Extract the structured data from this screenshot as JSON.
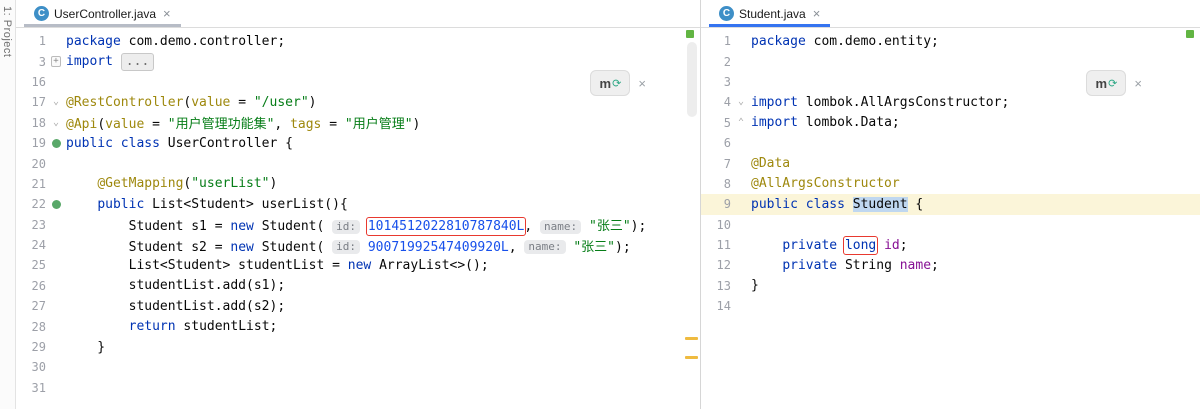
{
  "colors": {
    "accent_focused_tab": "#3574f0",
    "annotation_box_red": "#e8392f",
    "bean_icon_green": "#59a869",
    "inspection_ok_green": "#62b543",
    "warning_stripe_yellow": "#efbb40",
    "keyword_blue": "#0033b3",
    "string_green": "#067d17",
    "number_blue": "#1750eb"
  },
  "project_strip": {
    "label": "1: Project"
  },
  "inline_widget": {
    "logo": "m",
    "sync_icon": "circular-arrows",
    "close": "×"
  },
  "panes": [
    {
      "tab": {
        "icon_letter": "C",
        "title": "UserController.java",
        "close": "×"
      },
      "focused": false,
      "lines": [
        {
          "n": "1",
          "tokens": [
            {
              "c": "kw",
              "t": "package "
            },
            {
              "c": "txt",
              "t": "com.demo.controller;"
            }
          ]
        },
        {
          "n": "3",
          "icon": "plus",
          "tokens": [
            {
              "c": "kw",
              "t": "import "
            },
            {
              "c": "fold",
              "t": "..."
            }
          ]
        },
        {
          "n": "16",
          "tokens": []
        },
        {
          "n": "17",
          "icon": "chev",
          "tokens": [
            {
              "c": "ann",
              "t": "@RestController"
            },
            {
              "c": "txt",
              "t": "("
            },
            {
              "c": "ann",
              "t": "value"
            },
            {
              "c": "txt",
              "t": " = "
            },
            {
              "c": "str",
              "t": "\"/user\""
            },
            {
              "c": "txt",
              "t": ")"
            }
          ]
        },
        {
          "n": "18",
          "icon": "chev",
          "tokens": [
            {
              "c": "ann",
              "t": "@Api"
            },
            {
              "c": "txt",
              "t": "("
            },
            {
              "c": "ann",
              "t": "value"
            },
            {
              "c": "txt",
              "t": " = "
            },
            {
              "c": "str",
              "t": "\"用户管理功能集\""
            },
            {
              "c": "txt",
              "t": ", "
            },
            {
              "c": "ann",
              "t": "tags"
            },
            {
              "c": "txt",
              "t": " = "
            },
            {
              "c": "str",
              "t": "\"用户管理\""
            },
            {
              "c": "txt",
              "t": ")"
            }
          ]
        },
        {
          "n": "19",
          "icon": "bean",
          "tokens": [
            {
              "c": "kw",
              "t": "public class "
            },
            {
              "c": "txt",
              "t": "UserController {"
            }
          ]
        },
        {
          "n": "20",
          "tokens": []
        },
        {
          "n": "21",
          "tokens": [
            {
              "c": "txt",
              "t": "    "
            },
            {
              "c": "ann",
              "t": "@GetMapping"
            },
            {
              "c": "txt",
              "t": "("
            },
            {
              "c": "str",
              "t": "\"userList\""
            },
            {
              "c": "txt",
              "t": ")"
            }
          ]
        },
        {
          "n": "22",
          "icon": "bean",
          "tokens": [
            {
              "c": "txt",
              "t": "    "
            },
            {
              "c": "kw",
              "t": "public "
            },
            {
              "c": "txt",
              "t": "List<Student> userList(){"
            }
          ]
        },
        {
          "n": "23",
          "tokens": [
            {
              "c": "txt",
              "t": "        Student s1 = "
            },
            {
              "c": "kw",
              "t": "new "
            },
            {
              "c": "txt",
              "t": "Student( "
            },
            {
              "c": "inlay",
              "t": "id:"
            },
            {
              "c": "txt",
              "t": " "
            },
            {
              "c": "num",
              "t": "1014512022810787840L",
              "box": true
            },
            {
              "c": "txt",
              "t": ", "
            },
            {
              "c": "inlay",
              "t": "name:"
            },
            {
              "c": "txt",
              "t": " "
            },
            {
              "c": "str",
              "t": "\"张三\""
            },
            {
              "c": "txt",
              "t": ");"
            }
          ]
        },
        {
          "n": "24",
          "tokens": [
            {
              "c": "txt",
              "t": "        Student s2 = "
            },
            {
              "c": "kw",
              "t": "new "
            },
            {
              "c": "txt",
              "t": "Student( "
            },
            {
              "c": "inlay",
              "t": "id:"
            },
            {
              "c": "txt",
              "t": " "
            },
            {
              "c": "num",
              "t": "90071992547409920L"
            },
            {
              "c": "txt",
              "t": ", "
            },
            {
              "c": "inlay",
              "t": "name:"
            },
            {
              "c": "txt",
              "t": " "
            },
            {
              "c": "str",
              "t": "\"张三\""
            },
            {
              "c": "txt",
              "t": ");"
            }
          ]
        },
        {
          "n": "25",
          "tokens": [
            {
              "c": "txt",
              "t": "        List<Student> studentList = "
            },
            {
              "c": "kw",
              "t": "new "
            },
            {
              "c": "txt",
              "t": "ArrayList<>();"
            }
          ]
        },
        {
          "n": "26",
          "tokens": [
            {
              "c": "txt",
              "t": "        studentList.add(s1);"
            }
          ]
        },
        {
          "n": "27",
          "tokens": [
            {
              "c": "txt",
              "t": "        studentList.add(s2);"
            }
          ]
        },
        {
          "n": "28",
          "tokens": [
            {
              "c": "txt",
              "t": "        "
            },
            {
              "c": "kw",
              "t": "return "
            },
            {
              "c": "txt",
              "t": "studentList;"
            }
          ]
        },
        {
          "n": "29",
          "tokens": [
            {
              "c": "txt",
              "t": "    }"
            }
          ]
        },
        {
          "n": "30",
          "tokens": []
        },
        {
          "n": "31",
          "tokens": []
        }
      ]
    },
    {
      "tab": {
        "icon_letter": "C",
        "title": "Student.java",
        "close": "×"
      },
      "focused": true,
      "lines": [
        {
          "n": "1",
          "tokens": [
            {
              "c": "kw",
              "t": "package "
            },
            {
              "c": "txt",
              "t": "com.demo.entity;"
            }
          ]
        },
        {
          "n": "2",
          "tokens": []
        },
        {
          "n": "3",
          "tokens": []
        },
        {
          "n": "4",
          "icon": "chev",
          "tokens": [
            {
              "c": "kw",
              "t": "import "
            },
            {
              "c": "txt",
              "t": "lombok.AllArgsConstructor;"
            }
          ]
        },
        {
          "n": "5",
          "icon": "chevup",
          "tokens": [
            {
              "c": "kw",
              "t": "import "
            },
            {
              "c": "txt",
              "t": "lombok.Data;"
            }
          ]
        },
        {
          "n": "6",
          "tokens": []
        },
        {
          "n": "7",
          "tokens": [
            {
              "c": "ann",
              "t": "@Data"
            }
          ]
        },
        {
          "n": "8",
          "tokens": [
            {
              "c": "ann",
              "t": "@AllArgsConstructor"
            }
          ]
        },
        {
          "n": "9",
          "caret": true,
          "tokens": [
            {
              "c": "kw",
              "t": "public class "
            },
            {
              "c": "sel",
              "t": "Student"
            },
            {
              "c": "txt",
              "t": " {"
            }
          ]
        },
        {
          "n": "10",
          "tokens": []
        },
        {
          "n": "11",
          "tokens": [
            {
              "c": "txt",
              "t": "    "
            },
            {
              "c": "kw",
              "t": "private "
            },
            {
              "c": "kw",
              "t": "long",
              "box": true
            },
            {
              "c": "txt",
              "t": " "
            },
            {
              "c": "fld",
              "t": "id"
            },
            {
              "c": "txt",
              "t": ";"
            }
          ]
        },
        {
          "n": "12",
          "tokens": [
            {
              "c": "txt",
              "t": "    "
            },
            {
              "c": "kw",
              "t": "private "
            },
            {
              "c": "txt",
              "t": "String "
            },
            {
              "c": "fld",
              "t": "name"
            },
            {
              "c": "txt",
              "t": ";"
            }
          ]
        },
        {
          "n": "13",
          "tokens": [
            {
              "c": "txt",
              "t": "}"
            }
          ]
        },
        {
          "n": "14",
          "tokens": []
        }
      ]
    }
  ]
}
